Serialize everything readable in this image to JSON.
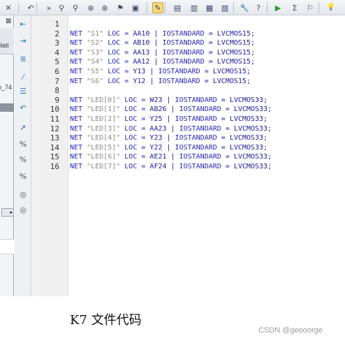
{
  "toolbar": {
    "items": [
      {
        "name": "close-icon",
        "glyph": "✕"
      },
      {
        "name": "undo-icon",
        "glyph": "↶"
      },
      {
        "name": "overflow-icon",
        "glyph": "»"
      },
      {
        "name": "search-icon",
        "glyph": "⚲"
      },
      {
        "name": "find-icon",
        "glyph": "⚲"
      },
      {
        "name": "find-in-files-icon",
        "glyph": "⊛"
      },
      {
        "name": "replace-icon",
        "glyph": "⊛"
      },
      {
        "name": "bookmark-icon",
        "glyph": "⚑"
      },
      {
        "name": "file-icon",
        "glyph": "▣"
      },
      {
        "name": "edit-icon",
        "glyph": "✎"
      },
      {
        "name": "window-tile-icon",
        "glyph": "▤"
      },
      {
        "name": "window-split-icon",
        "glyph": "▥"
      },
      {
        "name": "window-cascade-icon",
        "glyph": "▦"
      },
      {
        "name": "window-restore-icon",
        "glyph": "▧"
      },
      {
        "name": "wrench-icon",
        "glyph": "🔧"
      },
      {
        "name": "help-icon",
        "glyph": "?"
      },
      {
        "name": "run-icon",
        "glyph": "▶"
      },
      {
        "name": "sigma-icon",
        "glyph": "Σ"
      },
      {
        "name": "pin-icon",
        "glyph": "⚐"
      },
      {
        "name": "lightbulb-icon",
        "glyph": "💡"
      }
    ]
  },
  "left_panel": {
    "tab_close": "⊠",
    "partial_label_1": "ulati",
    "partial_label_2": "o_74",
    "scroll_arrow": "▸"
  },
  "action_bar": {
    "items": [
      {
        "name": "collapse-icon",
        "glyph": "⇤"
      },
      {
        "name": "expand-icon",
        "glyph": "⇥"
      },
      {
        "name": "document-icon",
        "glyph": "≣"
      },
      {
        "name": "comment-icon",
        "glyph": "⁄"
      },
      {
        "name": "indent-icon",
        "glyph": "☰"
      },
      {
        "name": "undo-small-icon",
        "glyph": "↶"
      },
      {
        "name": "arrow-icon",
        "glyph": "➚"
      },
      {
        "name": "percent-icon",
        "glyph": "%"
      },
      {
        "name": "percent-icon-2",
        "glyph": "%"
      },
      {
        "name": "percent-icon-3",
        "glyph": "%"
      },
      {
        "name": "circle-icon",
        "glyph": "◎"
      },
      {
        "name": "circle-icon-2",
        "glyph": "◎"
      }
    ]
  },
  "editor": {
    "lines": [
      {
        "n": "1",
        "text": ""
      },
      {
        "n": "2",
        "text": "NET \"S1\" LOC = AA10 | IOSTANDARD = LVCMOS15;"
      },
      {
        "n": "3",
        "text": "NET \"S2\" LOC = AB10 | IOSTANDARD = LVCMOS15;"
      },
      {
        "n": "4",
        "text": "NET \"S3\" LOC = AA13 | IOSTANDARD = LVCMOS15;"
      },
      {
        "n": "5",
        "text": "NET \"S4\" LOC = AA12 | IOSTANDARD = LVCMOS15;"
      },
      {
        "n": "6",
        "text": "NET \"S5\" LOC = Y13 | IOSTANDARD = LVCMOS15;"
      },
      {
        "n": "7",
        "text": "NET \"S6\" LOC = Y12 | IOSTANDARD = LVCMOS15;"
      },
      {
        "n": "8",
        "text": ""
      },
      {
        "n": "9",
        "text": "NET \"LED[0]\" LOC = W23 | IOSTANDARD = LVCMOS33;"
      },
      {
        "n": "10",
        "text": "NET \"LED[1]\" LOC = AB26 | IOSTANDARD = LVCMOS33;"
      },
      {
        "n": "11",
        "text": "NET \"LED[2]\" LOC = Y25 | IOSTANDARD = LVCMOS33;"
      },
      {
        "n": "12",
        "text": "NET \"LED[3]\" LOC = AA23 | IOSTANDARD = LVCMOS33;"
      },
      {
        "n": "13",
        "text": "NET \"LED[4]\" LOC = Y23 | IOSTANDARD = LVCMOS33;"
      },
      {
        "n": "14",
        "text": "NET \"LED[5]\" LOC = Y22 | IOSTANDARD = LVCMOS33;"
      },
      {
        "n": "15",
        "text": "NET \"LED[6]\" LOC = AE21 | IOSTANDARD = LVCMOS33;"
      },
      {
        "n": "16",
        "text": "NET \"LED[7]\" LOC = AF24 | IOSTANDARD = LVCMOS33;"
      }
    ]
  },
  "caption": "K7 文件代码",
  "watermark": "CSDN @geooorge"
}
